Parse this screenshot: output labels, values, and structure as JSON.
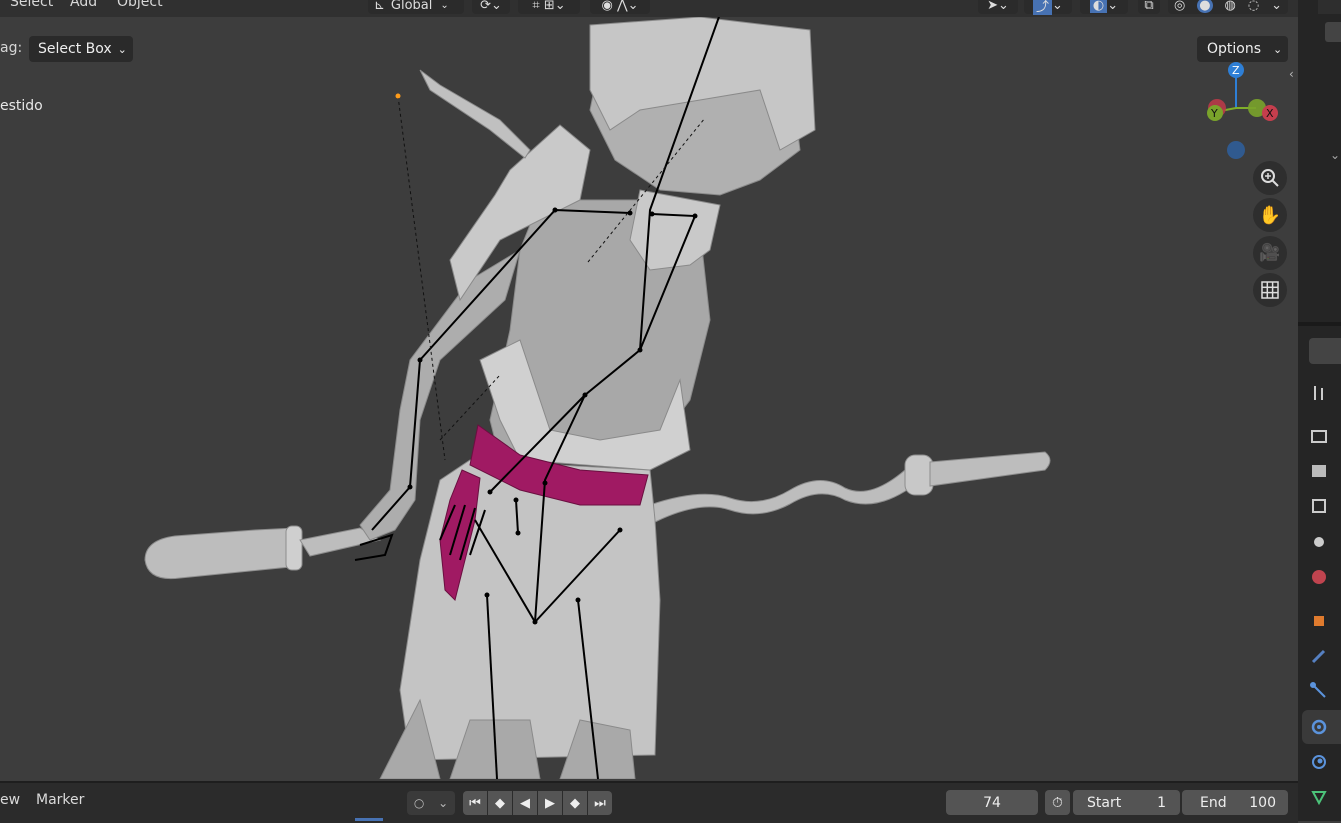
{
  "header": {
    "menus": [
      "Select",
      "Add",
      "Object"
    ],
    "transform_orientation": "Global"
  },
  "viewport": {
    "drag_label": "ag:",
    "drag_value": "Select Box",
    "options_label": "Options",
    "object_name": "estido",
    "gizmo": {
      "z": "Z",
      "y": "Y",
      "x": "X"
    },
    "nav_icons": [
      "zoom-icon",
      "hand-pan-icon",
      "camera-icon",
      "grid-icon"
    ],
    "colors": {
      "sash": "#a01a63",
      "bone": "#000000",
      "model": "#b8b8b8",
      "background": "#3d3d3d"
    }
  },
  "timeline": {
    "view_label": "ew",
    "marker_label": "Marker",
    "current_frame": "74",
    "start_label": "Start",
    "start_value": "1",
    "end_label": "End",
    "end_value": "100"
  },
  "properties": {
    "icons": [
      "tool-icon",
      "render-icon",
      "output-icon",
      "view-layer-icon",
      "scene-icon",
      "world-icon",
      "object-icon",
      "modifier-icon",
      "particles-icon",
      "physics-icon",
      "constraints-icon",
      "data-icon"
    ]
  }
}
